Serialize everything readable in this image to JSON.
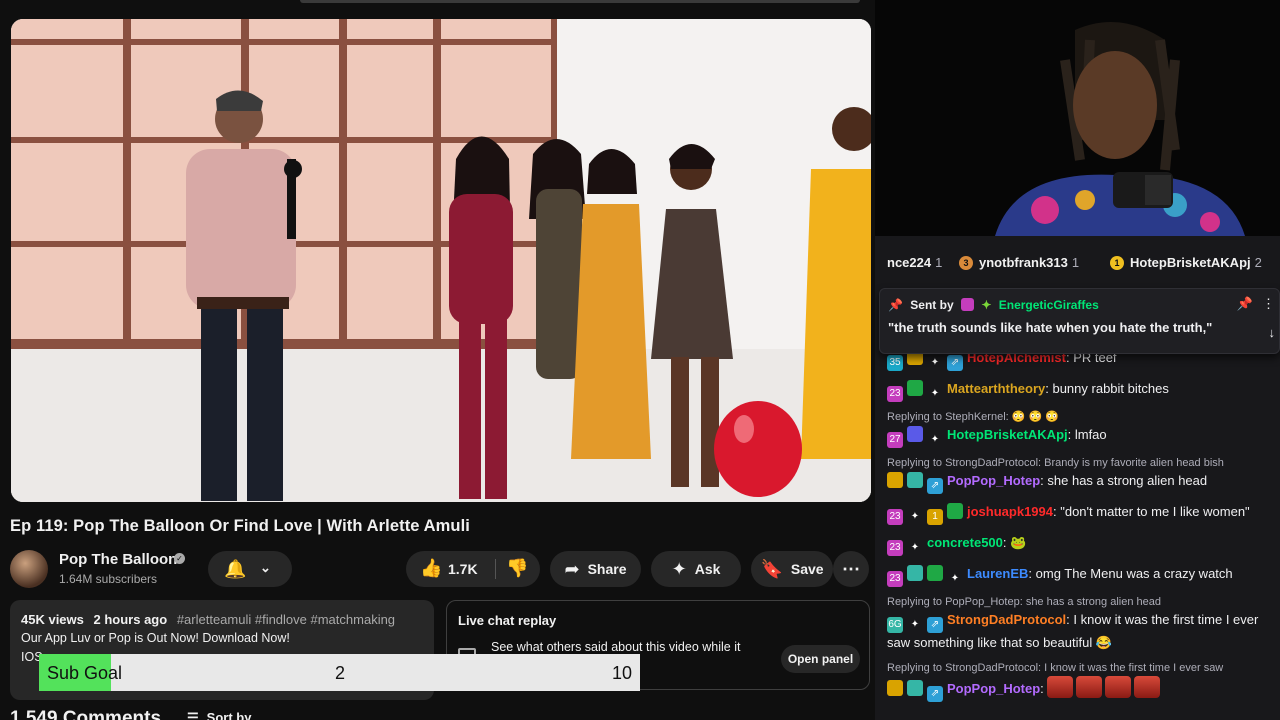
{
  "video": {
    "title": "Ep 119: Pop The Balloon Or Find Love | With Arlette Amuli"
  },
  "channel": {
    "name": "Pop The Balloon",
    "subscribers": "1.64M subscribers",
    "verified_mark": "✓"
  },
  "actions": {
    "bell_icon": "🔔",
    "chevron": "⌄",
    "like_count": "1.7K",
    "share_label": "Share",
    "ask_label": "Ask",
    "save_label": "Save",
    "more_label": "⋯"
  },
  "description": {
    "views": "45K views",
    "age": "2 hours ago",
    "hashtags": "#arletteamuli #findlove #matchmaking",
    "line1": "Our App Luv or Pop is Out Now! Download Now!",
    "line2": "IOS"
  },
  "live_chat": {
    "title": "Live chat replay",
    "text": "See what others said about this video while it",
    "button": "Open panel"
  },
  "comments": {
    "count_label": "1,549 Comments",
    "sort_label": "Sort by"
  },
  "sub_goal": {
    "label": "Sub Goal",
    "current": "2",
    "target": "10",
    "progress": 0.2,
    "fill_color": "#53e25b"
  },
  "chat": {
    "leaderboard": [
      {
        "name": "nce224",
        "count": "1",
        "rank": "",
        "color": "#efeff1"
      },
      {
        "name": "ynotbfrank313",
        "count": "1",
        "rank": "3",
        "color": "#efeff1"
      },
      {
        "name": "HotepBrisketAKApj",
        "count": "2",
        "rank": "1",
        "color": "#efeff1"
      }
    ],
    "pinned": {
      "pin_icon": "📌",
      "sent_by": "Sent by",
      "user": "EnergeticGiraffes",
      "message": "\"the truth sounds like hate when you hate the truth,\"",
      "more_icon": "⋮",
      "down_icon": "↓"
    },
    "messages": [
      {
        "reply": "",
        "user": "HotepAlchemist",
        "color": "#ff2a2a",
        "text": ": PR teef",
        "badges": [
          "b-cyan",
          "b-gold",
          "b-star",
          "b-gift"
        ],
        "badge_text": [
          "35",
          "",
          "✦",
          "⇗"
        ],
        "emotes": 0
      },
      {
        "reply": "",
        "user": "Mattearththeory",
        "color": "#daa520",
        "text": ": bunny rabbit bitches",
        "badges": [
          "b-pink",
          "b-green",
          "b-star"
        ],
        "badge_text": [
          "23",
          "",
          "✦"
        ],
        "emotes": 0
      },
      {
        "reply": "Replying to StephKernel: 😳 😳 😳",
        "user": "HotepBrisketAKApj",
        "color": "#00e676",
        "text": ": lmfao",
        "badges": [
          "b-pink",
          "b-bits",
          "b-star"
        ],
        "badge_text": [
          "27",
          "",
          "✦"
        ],
        "emotes": 0
      },
      {
        "reply": "Replying to StrongDadProtocol: Brandy is my favorite alien head bish",
        "user": "PopPop_Hotep",
        "color": "#b36bff",
        "text": ": she has a strong alien head",
        "badges": [
          "b-gold",
          "b-teal",
          "b-gift"
        ],
        "badge_text": [
          "",
          "",
          "⇗"
        ],
        "emotes": 0
      },
      {
        "reply": "",
        "user": "joshuapk1994",
        "color": "#ff2a2a",
        "text": ": \"don't matter to me I like women\"",
        "badges": [
          "b-pink",
          "b-star",
          "b-gold",
          "b-green"
        ],
        "badge_text": [
          "23",
          "✦",
          "1",
          ""
        ],
        "emotes": 0
      },
      {
        "reply": "",
        "user": "concrete500",
        "color": "#00e676",
        "text": ": 🐸",
        "badges": [
          "b-pink",
          "b-star"
        ],
        "badge_text": [
          "23",
          "✦"
        ],
        "emotes": 0
      },
      {
        "reply": "",
        "user": "LaurenEB",
        "color": "#3d8bff",
        "text": ": omg The Menu was a crazy watch",
        "badges": [
          "b-pink",
          "b-teal",
          "b-green",
          "b-star"
        ],
        "badge_text": [
          "23",
          "",
          "",
          "✦"
        ],
        "emotes": 0
      },
      {
        "reply": "Replying to PopPop_Hotep: she has a strong alien head",
        "user": "StrongDadProtocol",
        "color": "#ff7f24",
        "text": ": I know it was the first time I ever saw something like that so beautiful 😂",
        "badges": [
          "b-teal",
          "b-star",
          "b-gift"
        ],
        "badge_text": [
          "6G",
          "✦",
          "⇗"
        ],
        "emotes": 0
      },
      {
        "reply": "Replying to StrongDadProtocol: I know it was the first time I ever saw",
        "user": "PopPop_Hotep",
        "color": "#b36bff",
        "text": ": ",
        "badges": [
          "b-gold",
          "b-teal",
          "b-gift"
        ],
        "badge_text": [
          "",
          "",
          "⇗"
        ],
        "emotes": 4
      }
    ]
  }
}
